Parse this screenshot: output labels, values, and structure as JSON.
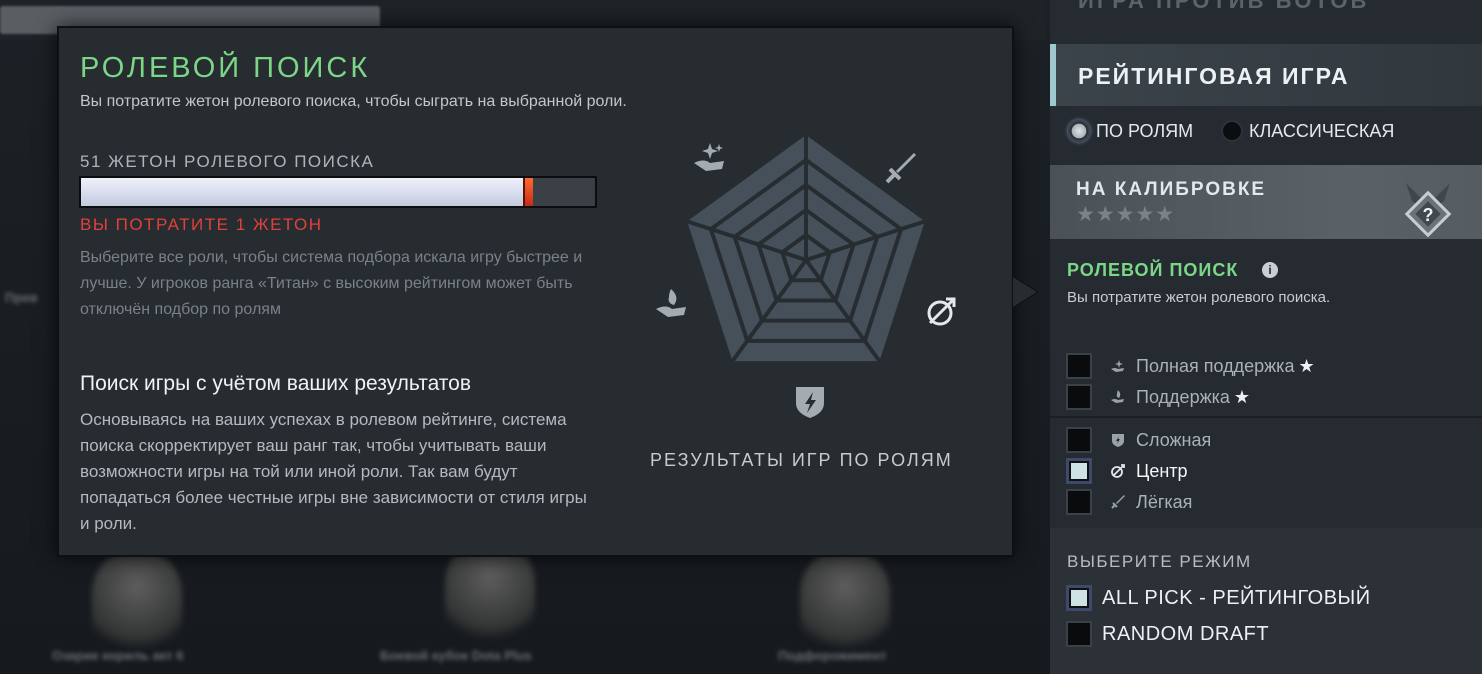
{
  "background": {
    "top_menu_text": "ИГРА ПРОТИВ БОТОВ"
  },
  "popup": {
    "title": "РОЛЕВОЙ ПОИСК",
    "subtitle": "Вы потратите жетон ролевого поиска, чтобы сыграть на выбранной роли.",
    "tokens_label": "51 ЖЕТОН РОЛЕВОГО ПОИСКА",
    "tokens_bar_fraction": 0.88,
    "spend_label": "ВЫ ПОТРАТИТЕ 1 ЖЕТОН",
    "hint": "Выберите все роли, чтобы система подбора искала игру быстрее и лучше. У игроков ранга «Титан» с высоким рейтингом может быть отключён подбор по ролям",
    "section_title": "Поиск игры с учётом ваших результатов",
    "section_body": "Основываясь на ваших успехах в ролевом рейтинге, система поиска скорректирует ваш ранг так, чтобы учитывать ваши возможности игры на той или иной роли. Так вам будут попадаться более честные игры вне зависимости от стиля игры и роли.",
    "chart_label": "РЕЗУЛЬТАТЫ ИГР ПО РОЛЯМ",
    "chart_axes_icons": [
      "sword-icon",
      "bow-target-icon",
      "shield-bolt-icon",
      "hand-flame-icon",
      "hand-sparkles-icon"
    ]
  },
  "panel": {
    "ranked_title": "РЕЙТИНГОВАЯ ИГРА",
    "radio_by_roles": "ПО РОЛЯМ",
    "radio_classic": "КЛАССИЧЕСКАЯ",
    "calibration_title": "НА КАЛИБРОВКЕ",
    "calibration_stars": "★★★★★",
    "calibration_badge": "?",
    "role_search_title": "РОЛЕВОЙ ПОИСК",
    "role_search_desc": "Вы потратите жетон ролевого поиска.",
    "roles": [
      {
        "label": "Полная поддержка",
        "star": "★",
        "checked": false
      },
      {
        "label": "Поддержка",
        "star": "★",
        "checked": false
      },
      {
        "label": "Сложная",
        "star": "",
        "checked": false
      },
      {
        "label": "Центр",
        "star": "",
        "checked": true
      },
      {
        "label": "Лёгкая",
        "star": "",
        "checked": false
      }
    ],
    "mode_title": "ВЫБЕРИТЕ РЕЖИМ",
    "modes": [
      {
        "label": "ALL PICK - РЕЙТИНГОВЫЙ",
        "checked": true
      },
      {
        "label": "RANDOM DRAFT",
        "checked": false
      }
    ]
  },
  "colors": {
    "accent_green": "#7bd787",
    "warning_red": "#e0413a",
    "panel_bg": "#252b31",
    "popup_bg": "#272c31"
  }
}
